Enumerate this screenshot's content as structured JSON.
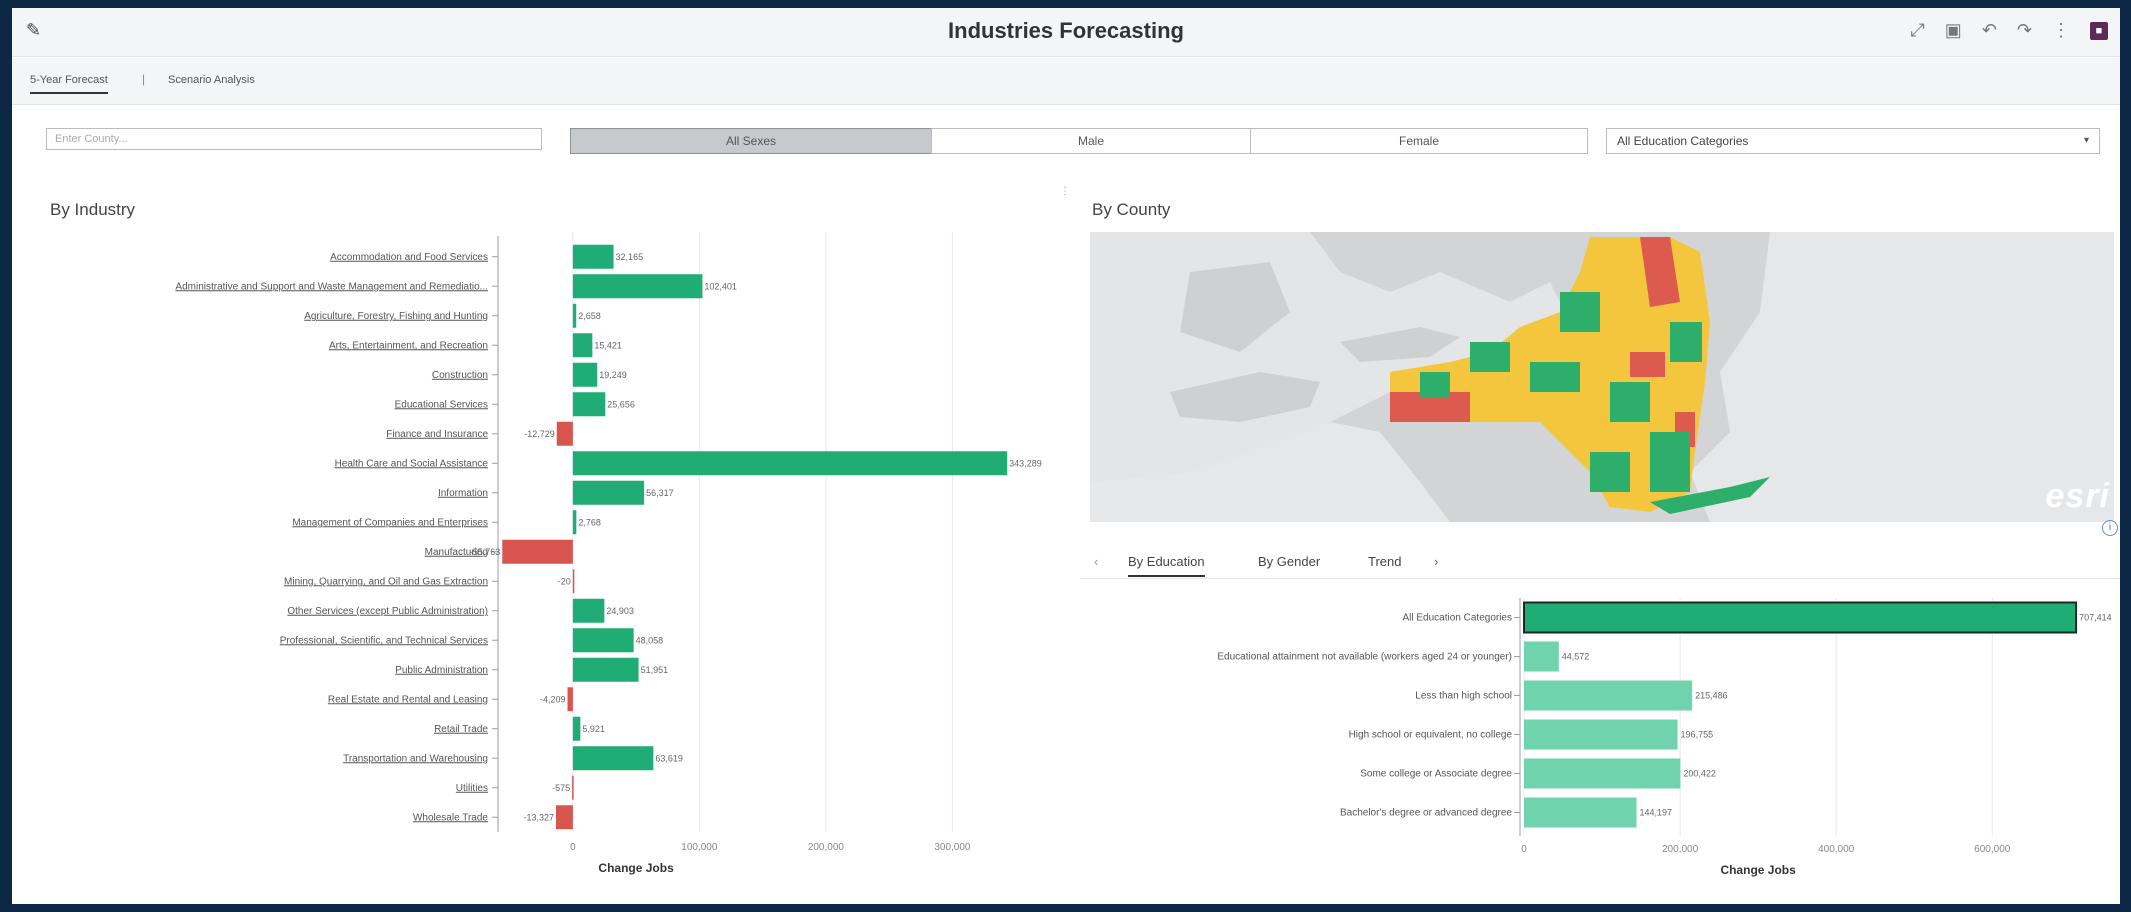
{
  "window": {
    "title": "Industries Forecasting"
  },
  "tabs": [
    {
      "label": "5-Year Forecast"
    },
    {
      "label": "Scenario Analysis"
    }
  ],
  "tab_separator": "|",
  "filters": {
    "county_placeholder": "Enter County...",
    "sex_options": [
      "All Sexes",
      "Male",
      "Female"
    ],
    "selected_sex": "All Sexes",
    "education_selected": "All Education Categories"
  },
  "sections": {
    "industry_title": "By Industry",
    "county_title": "By County"
  },
  "map": {
    "watermark": "esri"
  },
  "subtabs": [
    {
      "label": "By Education"
    },
    {
      "label": "By Gender"
    },
    {
      "label": "Trend"
    }
  ],
  "icons": {
    "edit": "pencil-icon",
    "toolbar": [
      "expand-icon",
      "save-icon",
      "undo-icon",
      "redo-icon",
      "more-icon",
      "user-badge-icon"
    ],
    "subtab_prev": "chevron-left-icon",
    "subtab_next": "chevron-right-icon",
    "info": "info-icon"
  },
  "colors": {
    "positive": "#1fac75",
    "negative": "#d8554f",
    "education_total": "#1fac75",
    "education_other": "#6fd3ae",
    "map_green": "#2eae6b",
    "map_yellow": "#f3c63e",
    "map_red": "#dd5a4f"
  },
  "chart_data": [
    {
      "type": "bar",
      "orientation": "horizontal",
      "categories": [
        "Accommodation and Food Services",
        "Administrative and Support and Waste Management and Remediatio...",
        "Agriculture, Forestry, Fishing and Hunting",
        "Arts, Entertainment, and Recreation",
        "Construction",
        "Educational Services",
        "Finance and Insurance",
        "Health Care and Social Assistance",
        "Information",
        "Management of Companies and Enterprises",
        "Manufacturing",
        "Mining, Quarrying, and Oil and Gas Extraction",
        "Other Services (except Public Administration)",
        "Professional, Scientific, and Technical Services",
        "Public Administration",
        "Real Estate and Rental and Leasing",
        "Retail Trade",
        "Transportation and Warehousing",
        "Utilities",
        "Wholesale Trade"
      ],
      "values": [
        32165,
        102401,
        2658,
        15421,
        19249,
        25656,
        -12729,
        343289,
        56317,
        2768,
        -55763,
        -20,
        24903,
        48058,
        51951,
        -4209,
        5921,
        63619,
        -575,
        -13327
      ],
      "data_labels": [
        "32,165",
        "102,401",
        "2,658",
        "15,421",
        "19,249",
        "25,656",
        "-12,729",
        "343,289",
        "56,317",
        "2,768",
        "-55,763",
        "-20",
        "24,903",
        "48,058",
        "51,951",
        "-4,209",
        "5,921",
        "63,619",
        "-575",
        "-13,327"
      ],
      "xlabel": "Change Jobs",
      "xlim": [
        -56000,
        355000
      ],
      "xticks": [
        0,
        100000,
        200000,
        300000
      ],
      "xtick_labels": [
        "0",
        "100,000",
        "200,000",
        "300,000"
      ],
      "grid": true
    },
    {
      "type": "bar",
      "orientation": "horizontal",
      "categories": [
        "All Education Categories",
        "Educational attainment not available (workers aged 24 or younger)",
        "Less than high school",
        "High school or equivalent, no college",
        "Some college or Associate degree",
        "Bachelor's degree or advanced degree"
      ],
      "values": [
        707414,
        44572,
        215486,
        196755,
        200422,
        144197
      ],
      "data_labels": [
        "707,414",
        "44,572",
        "215,486",
        "196,755",
        "200,422",
        "144,197"
      ],
      "xlabel": "Change Jobs",
      "xlim": [
        0,
        715000
      ],
      "xticks": [
        0,
        200000,
        400000,
        600000
      ],
      "xtick_labels": [
        "0",
        "200,000",
        "400,000",
        "600,000"
      ],
      "grid": true
    }
  ]
}
